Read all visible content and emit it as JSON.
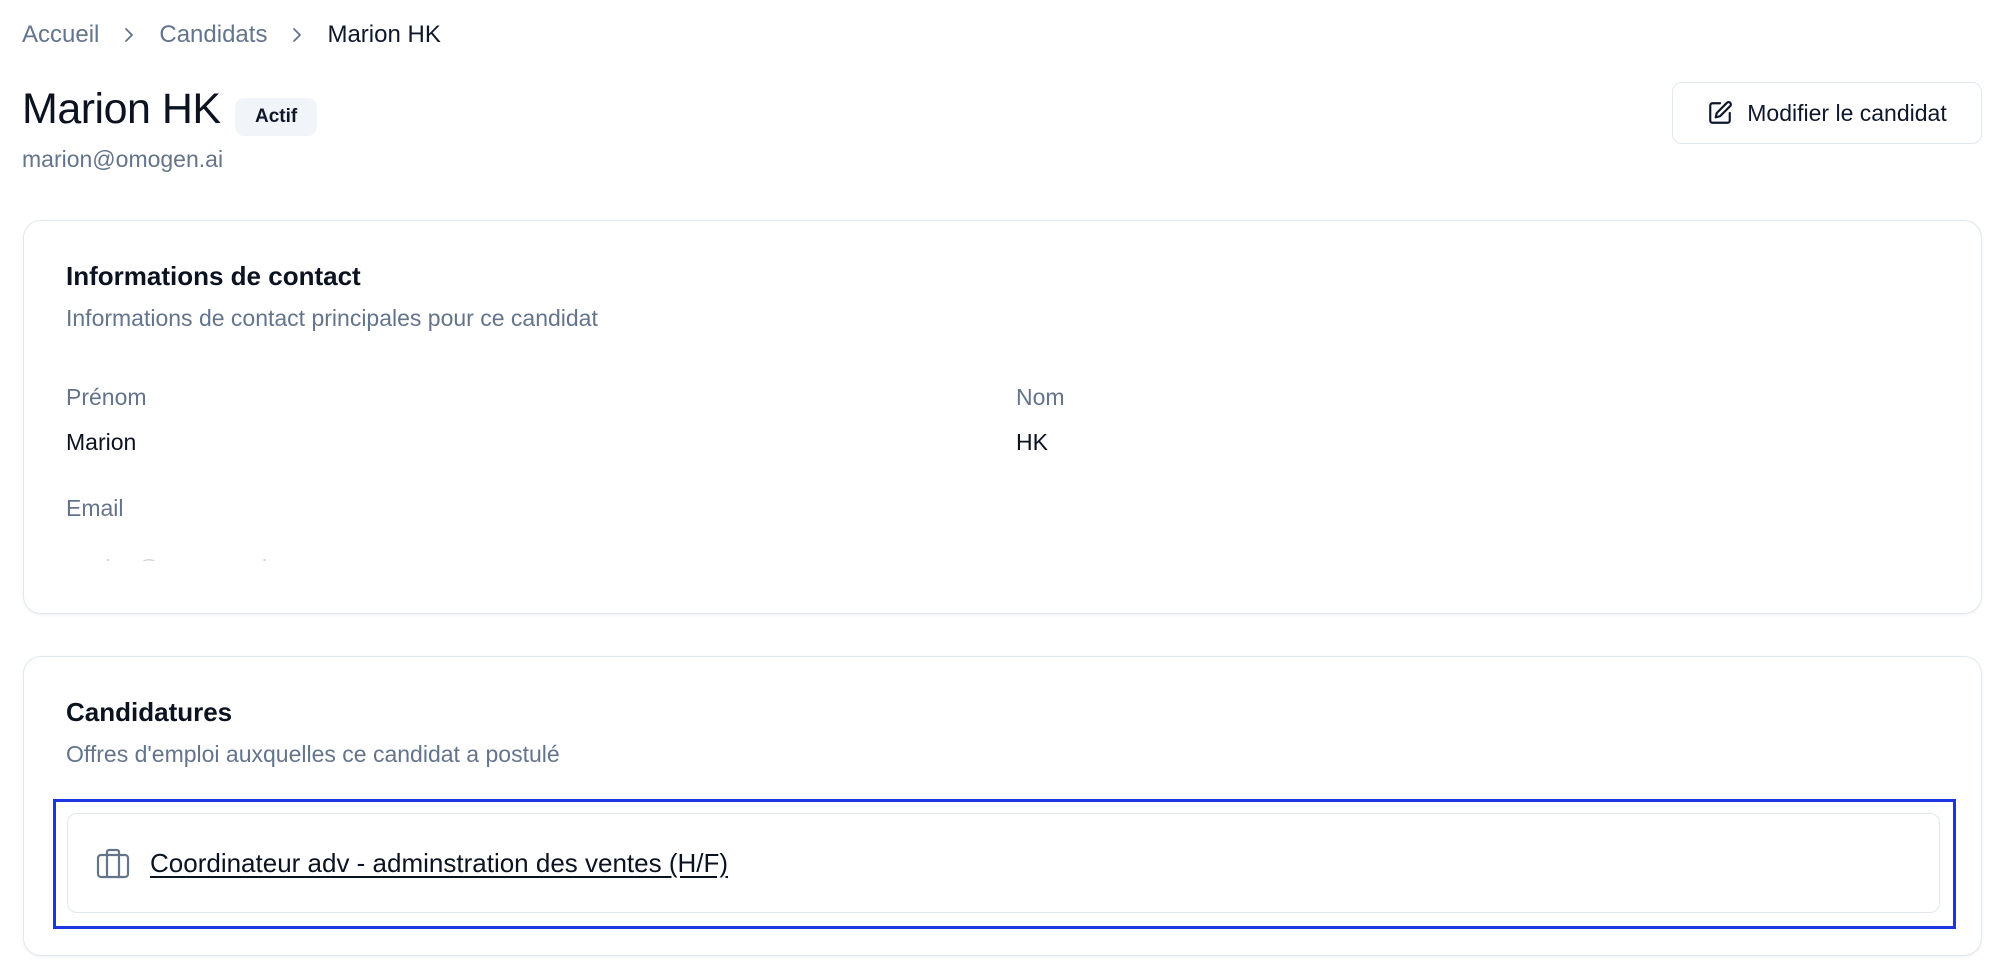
{
  "breadcrumb": {
    "items": [
      "Accueil",
      "Candidats",
      "Marion HK"
    ],
    "separator_icon": "chevron-right-icon"
  },
  "header": {
    "title": "Marion HK",
    "status_badge": "Actif",
    "email": "marion@omogen.ai",
    "edit_button_label": "Modifier le candidat",
    "edit_button_icon": "edit-square-icon"
  },
  "contact_card": {
    "title": "Informations de contact",
    "description": "Informations de contact principales pour ce candidat",
    "fields": {
      "first_name": {
        "label": "Prénom",
        "value": "Marion"
      },
      "last_name": {
        "label": "Nom",
        "value": "HK"
      },
      "email": {
        "label": "Email"
      }
    }
  },
  "applications_card": {
    "title": "Candidatures",
    "description": "Offres d'emploi auxquelles ce candidat a postulé",
    "items": [
      {
        "title": "Coordinateur adv - adminstration des ventes (H/F)",
        "icon": "briefcase-icon"
      }
    ]
  },
  "colors": {
    "muted_text": "#64748b",
    "primary_text": "#0f172a",
    "border": "#e2e8f0",
    "badge_bg": "#f1f5f9",
    "highlight": "#1d35e0"
  }
}
